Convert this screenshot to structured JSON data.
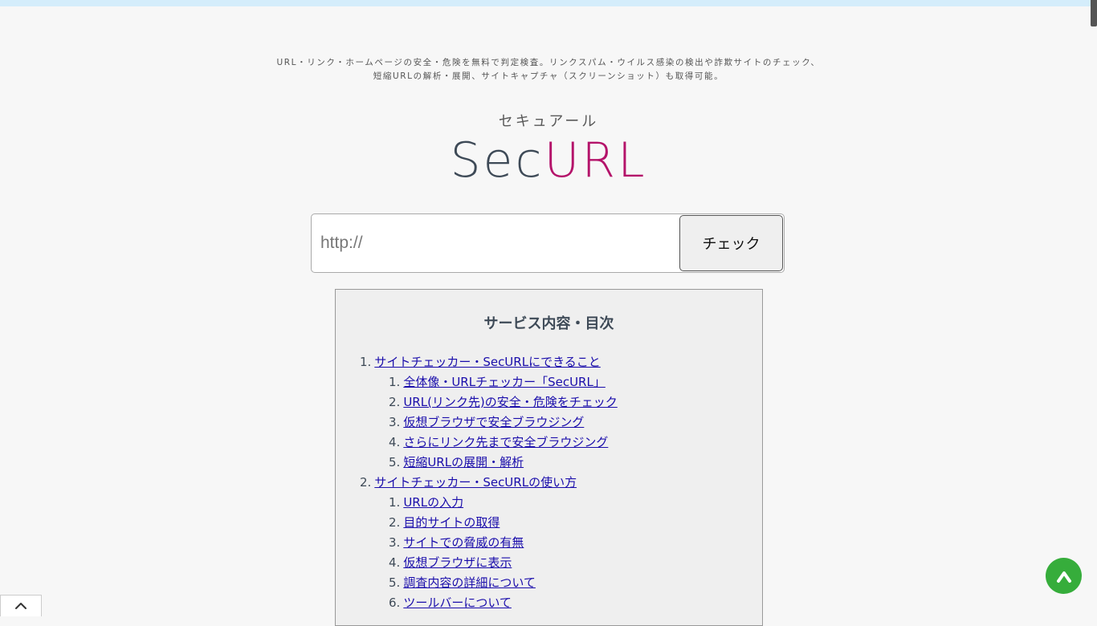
{
  "header": {
    "tagline_line1": "URL・リンク・ホームページの安全・危険を無料で判定検査。リンクスパム・ウイルス感染の検出や詐欺サイトのチェック、",
    "tagline_line2": "短縮URLの解析・展開、サイトキャプチャ（スクリーンショット）も取得可能。",
    "logo_kana": "セキュアール",
    "logo_part1": "Sec",
    "logo_part2": "URL"
  },
  "search": {
    "placeholder": "http://",
    "value": "",
    "button_label": "チェック"
  },
  "toc": {
    "title": "サービス内容・目次",
    "items": [
      {
        "num": "1.",
        "label": "サイトチェッカー・SecURLにできること",
        "level": 1
      },
      {
        "num": "1.",
        "label": "全体像・URLチェッカー「SecURL」",
        "level": 2
      },
      {
        "num": "2.",
        "label": "URL(リンク先)の安全・危険をチェック",
        "level": 2
      },
      {
        "num": "3.",
        "label": "仮想ブラウザで安全ブラウジング",
        "level": 2
      },
      {
        "num": "4.",
        "label": "さらにリンク先まで安全ブラウジング",
        "level": 2
      },
      {
        "num": "5.",
        "label": "短縮URLの展開・解析",
        "level": 2
      },
      {
        "num": "2.",
        "label": "サイトチェッカー・SecURLの使い方",
        "level": 1
      },
      {
        "num": "1.",
        "label": "URLの入力",
        "level": 2
      },
      {
        "num": "2.",
        "label": "目的サイトの取得",
        "level": 2
      },
      {
        "num": "3.",
        "label": "サイトでの脅威の有無",
        "level": 2
      },
      {
        "num": "4.",
        "label": "仮想ブラウザに表示",
        "level": 2
      },
      {
        "num": "5.",
        "label": "調査内容の詳細について",
        "level": 2
      },
      {
        "num": "6.",
        "label": "ツールバーについて",
        "level": 2
      }
    ]
  },
  "controls": {
    "scroll_top_icon": "double-chevron-up-icon",
    "bottom_tab_icon": "chevron-up-icon"
  },
  "colors": {
    "accent": "#b4136a",
    "logo_dark": "#3e4a57",
    "top_button": "#36ad3b",
    "link": "#1a0dab"
  }
}
